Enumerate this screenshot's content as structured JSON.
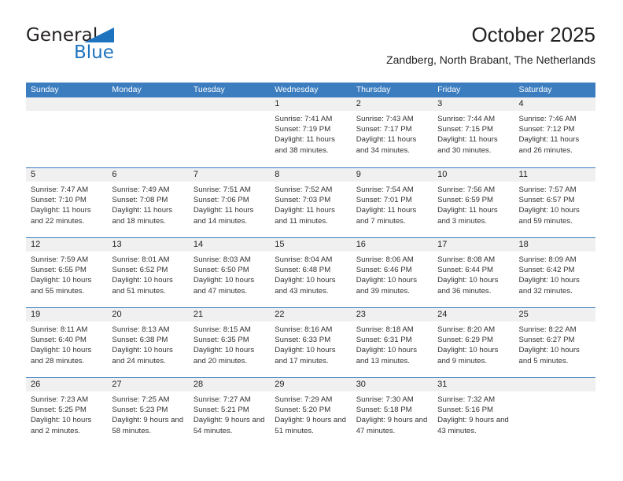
{
  "brand": {
    "name_part1": "General",
    "name_part2": "Blue",
    "triangle_icon": "triangle-icon",
    "accent_color": "#1e73be"
  },
  "header": {
    "title": "October 2025",
    "subtitle": "Zandberg, North Brabant, The Netherlands"
  },
  "theme": {
    "header_bar_color": "#3b7dbf",
    "daynum_band_color": "#f0f0f0",
    "text_color": "#222222"
  },
  "weekdays": [
    "Sunday",
    "Monday",
    "Tuesday",
    "Wednesday",
    "Thursday",
    "Friday",
    "Saturday"
  ],
  "weeks": [
    [
      {
        "day": "",
        "sunrise": "",
        "sunset": "",
        "daylight": ""
      },
      {
        "day": "",
        "sunrise": "",
        "sunset": "",
        "daylight": ""
      },
      {
        "day": "",
        "sunrise": "",
        "sunset": "",
        "daylight": ""
      },
      {
        "day": "1",
        "sunrise": "Sunrise: 7:41 AM",
        "sunset": "Sunset: 7:19 PM",
        "daylight": "Daylight: 11 hours and 38 minutes."
      },
      {
        "day": "2",
        "sunrise": "Sunrise: 7:43 AM",
        "sunset": "Sunset: 7:17 PM",
        "daylight": "Daylight: 11 hours and 34 minutes."
      },
      {
        "day": "3",
        "sunrise": "Sunrise: 7:44 AM",
        "sunset": "Sunset: 7:15 PM",
        "daylight": "Daylight: 11 hours and 30 minutes."
      },
      {
        "day": "4",
        "sunrise": "Sunrise: 7:46 AM",
        "sunset": "Sunset: 7:12 PM",
        "daylight": "Daylight: 11 hours and 26 minutes."
      }
    ],
    [
      {
        "day": "5",
        "sunrise": "Sunrise: 7:47 AM",
        "sunset": "Sunset: 7:10 PM",
        "daylight": "Daylight: 11 hours and 22 minutes."
      },
      {
        "day": "6",
        "sunrise": "Sunrise: 7:49 AM",
        "sunset": "Sunset: 7:08 PM",
        "daylight": "Daylight: 11 hours and 18 minutes."
      },
      {
        "day": "7",
        "sunrise": "Sunrise: 7:51 AM",
        "sunset": "Sunset: 7:06 PM",
        "daylight": "Daylight: 11 hours and 14 minutes."
      },
      {
        "day": "8",
        "sunrise": "Sunrise: 7:52 AM",
        "sunset": "Sunset: 7:03 PM",
        "daylight": "Daylight: 11 hours and 11 minutes."
      },
      {
        "day": "9",
        "sunrise": "Sunrise: 7:54 AM",
        "sunset": "Sunset: 7:01 PM",
        "daylight": "Daylight: 11 hours and 7 minutes."
      },
      {
        "day": "10",
        "sunrise": "Sunrise: 7:56 AM",
        "sunset": "Sunset: 6:59 PM",
        "daylight": "Daylight: 11 hours and 3 minutes."
      },
      {
        "day": "11",
        "sunrise": "Sunrise: 7:57 AM",
        "sunset": "Sunset: 6:57 PM",
        "daylight": "Daylight: 10 hours and 59 minutes."
      }
    ],
    [
      {
        "day": "12",
        "sunrise": "Sunrise: 7:59 AM",
        "sunset": "Sunset: 6:55 PM",
        "daylight": "Daylight: 10 hours and 55 minutes."
      },
      {
        "day": "13",
        "sunrise": "Sunrise: 8:01 AM",
        "sunset": "Sunset: 6:52 PM",
        "daylight": "Daylight: 10 hours and 51 minutes."
      },
      {
        "day": "14",
        "sunrise": "Sunrise: 8:03 AM",
        "sunset": "Sunset: 6:50 PM",
        "daylight": "Daylight: 10 hours and 47 minutes."
      },
      {
        "day": "15",
        "sunrise": "Sunrise: 8:04 AM",
        "sunset": "Sunset: 6:48 PM",
        "daylight": "Daylight: 10 hours and 43 minutes."
      },
      {
        "day": "16",
        "sunrise": "Sunrise: 8:06 AM",
        "sunset": "Sunset: 6:46 PM",
        "daylight": "Daylight: 10 hours and 39 minutes."
      },
      {
        "day": "17",
        "sunrise": "Sunrise: 8:08 AM",
        "sunset": "Sunset: 6:44 PM",
        "daylight": "Daylight: 10 hours and 36 minutes."
      },
      {
        "day": "18",
        "sunrise": "Sunrise: 8:09 AM",
        "sunset": "Sunset: 6:42 PM",
        "daylight": "Daylight: 10 hours and 32 minutes."
      }
    ],
    [
      {
        "day": "19",
        "sunrise": "Sunrise: 8:11 AM",
        "sunset": "Sunset: 6:40 PM",
        "daylight": "Daylight: 10 hours and 28 minutes."
      },
      {
        "day": "20",
        "sunrise": "Sunrise: 8:13 AM",
        "sunset": "Sunset: 6:38 PM",
        "daylight": "Daylight: 10 hours and 24 minutes."
      },
      {
        "day": "21",
        "sunrise": "Sunrise: 8:15 AM",
        "sunset": "Sunset: 6:35 PM",
        "daylight": "Daylight: 10 hours and 20 minutes."
      },
      {
        "day": "22",
        "sunrise": "Sunrise: 8:16 AM",
        "sunset": "Sunset: 6:33 PM",
        "daylight": "Daylight: 10 hours and 17 minutes."
      },
      {
        "day": "23",
        "sunrise": "Sunrise: 8:18 AM",
        "sunset": "Sunset: 6:31 PM",
        "daylight": "Daylight: 10 hours and 13 minutes."
      },
      {
        "day": "24",
        "sunrise": "Sunrise: 8:20 AM",
        "sunset": "Sunset: 6:29 PM",
        "daylight": "Daylight: 10 hours and 9 minutes."
      },
      {
        "day": "25",
        "sunrise": "Sunrise: 8:22 AM",
        "sunset": "Sunset: 6:27 PM",
        "daylight": "Daylight: 10 hours and 5 minutes."
      }
    ],
    [
      {
        "day": "26",
        "sunrise": "Sunrise: 7:23 AM",
        "sunset": "Sunset: 5:25 PM",
        "daylight": "Daylight: 10 hours and 2 minutes."
      },
      {
        "day": "27",
        "sunrise": "Sunrise: 7:25 AM",
        "sunset": "Sunset: 5:23 PM",
        "daylight": "Daylight: 9 hours and 58 minutes."
      },
      {
        "day": "28",
        "sunrise": "Sunrise: 7:27 AM",
        "sunset": "Sunset: 5:21 PM",
        "daylight": "Daylight: 9 hours and 54 minutes."
      },
      {
        "day": "29",
        "sunrise": "Sunrise: 7:29 AM",
        "sunset": "Sunset: 5:20 PM",
        "daylight": "Daylight: 9 hours and 51 minutes."
      },
      {
        "day": "30",
        "sunrise": "Sunrise: 7:30 AM",
        "sunset": "Sunset: 5:18 PM",
        "daylight": "Daylight: 9 hours and 47 minutes."
      },
      {
        "day": "31",
        "sunrise": "Sunrise: 7:32 AM",
        "sunset": "Sunset: 5:16 PM",
        "daylight": "Daylight: 9 hours and 43 minutes."
      },
      {
        "day": "",
        "sunrise": "",
        "sunset": "",
        "daylight": ""
      }
    ]
  ]
}
